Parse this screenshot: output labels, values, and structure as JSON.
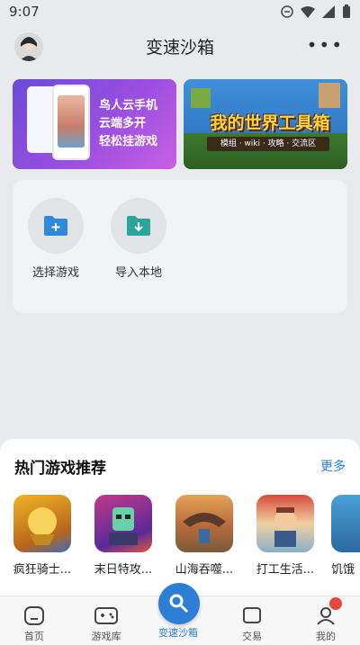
{
  "status_bar": {
    "time": "9:07"
  },
  "header": {
    "title": "变速沙箱"
  },
  "banners": [
    {
      "lines": [
        "鸟人云手机",
        "云端多开",
        "轻松挂游戏"
      ]
    },
    {
      "headline": "我的世界工具箱",
      "sub": "模组 · wiki · 攻略 · 交流区"
    }
  ],
  "actions": [
    {
      "label": "选择游戏",
      "icon": "folder-plus-icon"
    },
    {
      "label": "导入本地",
      "icon": "folder-download-icon"
    }
  ],
  "recommend": {
    "title": "热门游戏推荐",
    "more": "更多",
    "games": [
      {
        "name": "疯狂骑士..."
      },
      {
        "name": "末日特攻..."
      },
      {
        "name": "山海吞噬..."
      },
      {
        "name": "打工生活..."
      },
      {
        "name": "饥饿"
      }
    ]
  },
  "nav": {
    "items": [
      {
        "label": "首页",
        "icon": "home-icon"
      },
      {
        "label": "游戏库",
        "icon": "gamepad-icon"
      },
      {
        "label": "变速沙箱",
        "icon": "speed-icon"
      },
      {
        "label": "交易",
        "icon": "trade-icon"
      },
      {
        "label": "我的",
        "icon": "profile-icon"
      }
    ]
  },
  "colors": {
    "accent": "#2d7fd6",
    "background": "#e9eaee"
  }
}
